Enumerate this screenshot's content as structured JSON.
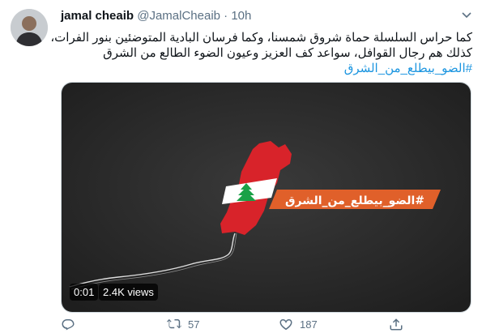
{
  "tweet": {
    "display_name": "jamal cheaib",
    "handle": "@JamalCheaib",
    "separator": "·",
    "time": "10h",
    "text_lines": [
      "كما حراس السلسلة حماة شروق شمسنا، وكما فرسان البادية المتوضئين بنور الفرات،",
      "كذلك هم رجال القوافل، سواعد كف العزيز وعيون الضوء الطالع من الشرق"
    ],
    "hashtag": "#الضو_بيطلع_من_الشرق"
  },
  "media": {
    "banner_text": "#الضو_بيطلع_من_الشرق",
    "duration": "0:01",
    "views": "2.4K views",
    "banner_color": "#e0602a",
    "background_color": "#2b2b2b"
  },
  "actions": {
    "reply_icon": "reply-icon",
    "retweet_icon": "retweet-icon",
    "retweet_count": "57",
    "like_icon": "like-icon",
    "like_count": "187",
    "share_icon": "share-icon"
  }
}
